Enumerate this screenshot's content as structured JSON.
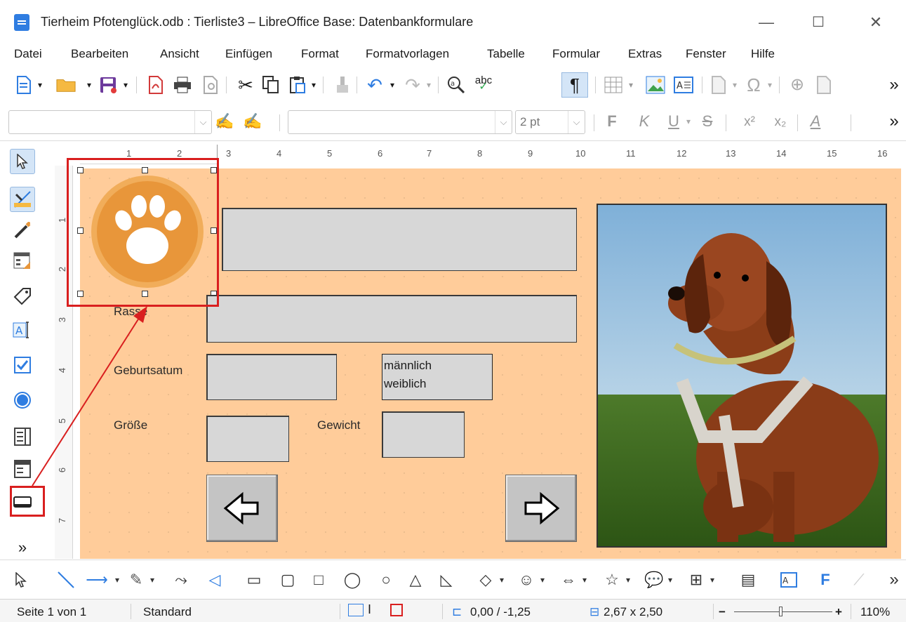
{
  "window": {
    "title": "Tierheim Pfotenglück.odb : Tierliste3 – LibreOffice Base: Datenbankformulare",
    "minimize_glyph": "—",
    "maximize_glyph": "☐",
    "close_glyph": "✕"
  },
  "menu": [
    "Datei",
    "Bearbeiten",
    "Ansicht",
    "Einfügen",
    "Format",
    "Formatvorlagen",
    "Tabelle",
    "Formular",
    "Extras",
    "Fenster",
    "Hilfe"
  ],
  "toolbar2": {
    "font_size_value": "2 pt",
    "bold_glyph": "F",
    "italic_glyph": "K",
    "underline_glyph": "U",
    "strike_glyph": "S",
    "superscript_glyph": "x²",
    "subscript_glyph": "x₂",
    "overflow_glyph": "»"
  },
  "toolbar1": {
    "overflow_glyph": "»",
    "spellcheck_text": "abc"
  },
  "ruler": {
    "h_ticks": [
      "1",
      "2",
      "3",
      "4",
      "5",
      "6",
      "7",
      "8",
      "9",
      "10",
      "11",
      "12",
      "13",
      "14",
      "15",
      "16"
    ],
    "v_ticks": [
      "1",
      "2",
      "3",
      "4",
      "5",
      "6",
      "7"
    ]
  },
  "left_toolbar": {
    "overflow_glyph": "»"
  },
  "form": {
    "rasse_label": "Rasse",
    "geburtsatum_label": "Geburtsatum",
    "groesse_label": "Größe",
    "gewicht_label": "Gewicht",
    "gender_options": [
      "männlich",
      "weiblich"
    ]
  },
  "statusbar": {
    "page": "Seite 1 von 1",
    "style": "Standard",
    "position": "0,00 / -1,25",
    "size": "2,67 x 2,50",
    "zoom": "110%",
    "zoom_minus": "−",
    "zoom_plus": "+"
  },
  "drawbar": {
    "overflow_glyph": "»"
  },
  "colors": {
    "canvas_bg": "#ffcc9a",
    "highlight_red": "#d91f1f",
    "field_gray": "#d7d7d7",
    "paw_orange": "#e8963a"
  }
}
